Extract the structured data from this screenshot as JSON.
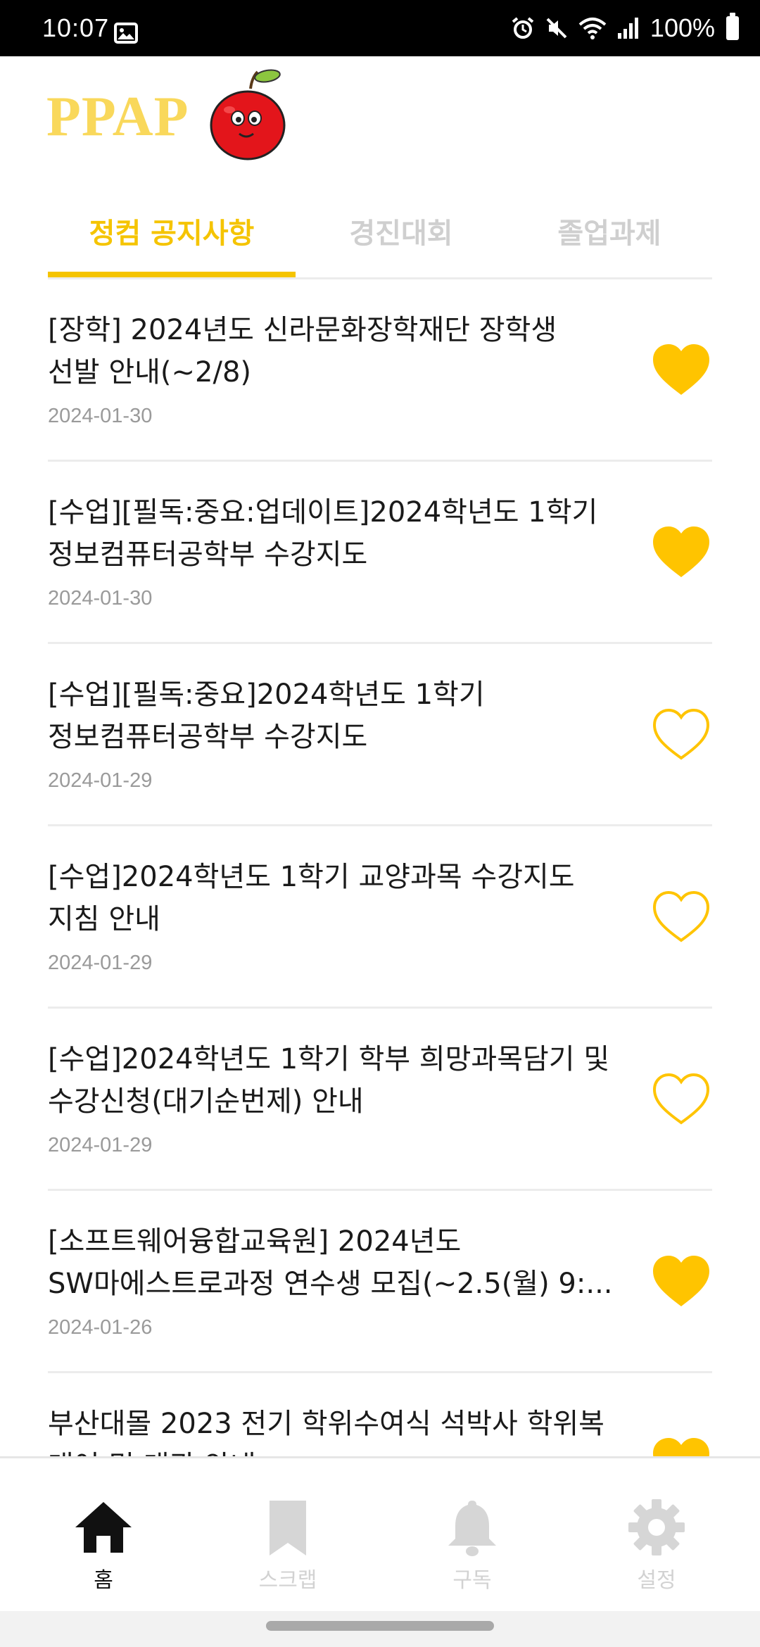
{
  "status_bar": {
    "time": "10:07",
    "battery": "100%",
    "icons": [
      "image-icon",
      "alarm-icon",
      "mute-icon",
      "wifi-icon",
      "signal-icon",
      "battery-icon"
    ]
  },
  "header": {
    "logo_text": "PPAP",
    "mascot_icon": "apple-mascot-icon"
  },
  "tabs": [
    {
      "label": "정컴 공지사항",
      "active": true
    },
    {
      "label": "경진대회",
      "active": false
    },
    {
      "label": "졸업과제",
      "active": false
    }
  ],
  "notices": [
    {
      "line1": "[장학] 2024년도 신라문화장학재단 장학생",
      "line2": "선발 안내(~2/8)",
      "date": "2024-01-30",
      "favorited": true
    },
    {
      "line1": "[수업][필독:중요:업데이트]2024학년도 1학기",
      "line2": "정보컴퓨터공학부 수강지도",
      "date": "2024-01-30",
      "favorited": true
    },
    {
      "line1": "[수업][필독:중요]2024학년도 1학기",
      "line2": "정보컴퓨터공학부 수강지도",
      "date": "2024-01-29",
      "favorited": false
    },
    {
      "line1": "[수업]2024학년도 1학기 교양과목 수강지도",
      "line2": "지침 안내",
      "date": "2024-01-29",
      "favorited": false
    },
    {
      "line1": "[수업]2024학년도 1학기 학부 희망과목담기 및",
      "line2": "수강신청(대기순번제) 안내",
      "date": "2024-01-29",
      "favorited": false
    },
    {
      "line1": "[소프트웨어융합교육원] 2024년도",
      "line2": "SW마에스트로과정 연수생 모집(~2.5(월) 9:...",
      "date": "2024-01-26",
      "favorited": true
    },
    {
      "line1": "부산대몰 2023 전기 학위수여식 석박사 학위복",
      "line2": "대여 및 대관 안내",
      "date": "",
      "favorited": true
    }
  ],
  "bottom_nav": [
    {
      "label": "홈",
      "icon": "home-icon",
      "active": true
    },
    {
      "label": "스크랩",
      "icon": "bookmark-icon",
      "active": false
    },
    {
      "label": "구독",
      "icon": "bell-icon",
      "active": false
    },
    {
      "label": "설정",
      "icon": "gear-icon",
      "active": false
    }
  ],
  "colors": {
    "accent": "#f5c400",
    "logo": "#f9d85b",
    "inactive": "#cfcfcf",
    "date": "#9a9a9a"
  }
}
